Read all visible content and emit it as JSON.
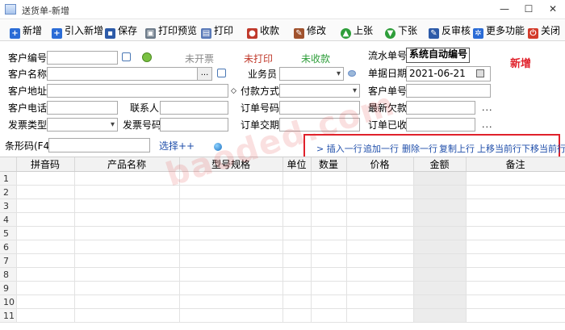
{
  "window": {
    "title": "送货单-新增",
    "min": "—",
    "max": "☐",
    "close": "✕"
  },
  "toolbar": [
    {
      "label": "新增",
      "icon": "add-icon",
      "color": "#2b6cd6",
      "glyph": "+"
    },
    {
      "label": "引入新增",
      "icon": "import-add-icon",
      "color": "#2b6cd6",
      "glyph": "+"
    },
    {
      "label": "保存",
      "icon": "save-icon",
      "color": "#2c5aa8",
      "glyph": "▪"
    },
    {
      "label": "打印预览",
      "icon": "print-preview-icon",
      "color": "#6d7b8a",
      "glyph": "▣"
    },
    {
      "label": "打印",
      "icon": "print-icon",
      "color": "#5a7ab8",
      "glyph": "▤"
    },
    {
      "label": "收款",
      "icon": "receive-payment-icon",
      "color": "#c0392b",
      "glyph": "●"
    },
    {
      "label": "修改",
      "icon": "edit-icon",
      "color": "#a0522d",
      "glyph": "✎"
    },
    {
      "label": "上张",
      "icon": "previous-icon",
      "color": "#2e9e3a",
      "glyph": "▲"
    },
    {
      "label": "下张",
      "icon": "next-icon",
      "color": "#2e9e3a",
      "glyph": "▼"
    },
    {
      "label": "反审核",
      "icon": "unaudit-icon",
      "color": "#2c5aa8",
      "glyph": "✎"
    },
    {
      "label": "更多功能",
      "icon": "more-functions-icon",
      "color": "#2b6cd6",
      "glyph": "✲"
    },
    {
      "label": "关闭",
      "icon": "close-icon",
      "color": "#d33b2a",
      "glyph": "⏻"
    }
  ],
  "form": {
    "customer_code": {
      "label": "客户编号",
      "value": ""
    },
    "customer_name": {
      "label": "客户名称",
      "value": ""
    },
    "customer_address": {
      "label": "客户地址",
      "value": ""
    },
    "customer_phone": {
      "label": "客户电话",
      "value": ""
    },
    "contact": {
      "label": "联系人",
      "value": ""
    },
    "invoice_type": {
      "label": "发票类型",
      "value": ""
    },
    "invoice_no": {
      "label": "发票号码",
      "value": ""
    },
    "salesperson": {
      "label": "业务员",
      "value": ""
    },
    "payment_method": {
      "label": "付款方式",
      "value": ""
    },
    "order_code": {
      "label": "订单号码",
      "value": ""
    },
    "order_due": {
      "label": "订单交期",
      "value": ""
    },
    "serial_no": {
      "label": "流水单号",
      "value": "系统自动编号"
    },
    "doc_date": {
      "label": "单据日期",
      "value": "2021-06-21"
    },
    "customer_order_no": {
      "label": "客户单号",
      "value": ""
    },
    "latest_debt": {
      "label": "最新欠款",
      "value": ""
    },
    "order_received": {
      "label": "订单已收",
      "value": ""
    },
    "status_invoice": "未开票",
    "status_print": "未打印",
    "status_payment": "未收款",
    "mode_badge": "新增",
    "ellipsis": "...",
    "colors": {
      "status_invoice": "#8a8a8a",
      "status_print": "#c0392b",
      "status_payment": "#2e9e3a",
      "badge": "#e0212b"
    }
  },
  "barcode": {
    "label": "条形码(F4)",
    "value": "",
    "select_label": "选择++"
  },
  "row_actions": [
    "> 插入一行",
    "追加一行",
    "删除一行",
    "复制上行",
    "上移当前行",
    "下移当前行"
  ],
  "grid": {
    "columns": [
      "拼音码",
      "产品名称",
      "型号规格",
      "单位",
      "数量",
      "价格",
      "金额",
      "备注"
    ],
    "rows": [
      "1",
      "2",
      "3",
      "4",
      "5",
      "6",
      "7",
      "8",
      "9",
      "10",
      "11"
    ]
  },
  "watermark": "baoded.com"
}
